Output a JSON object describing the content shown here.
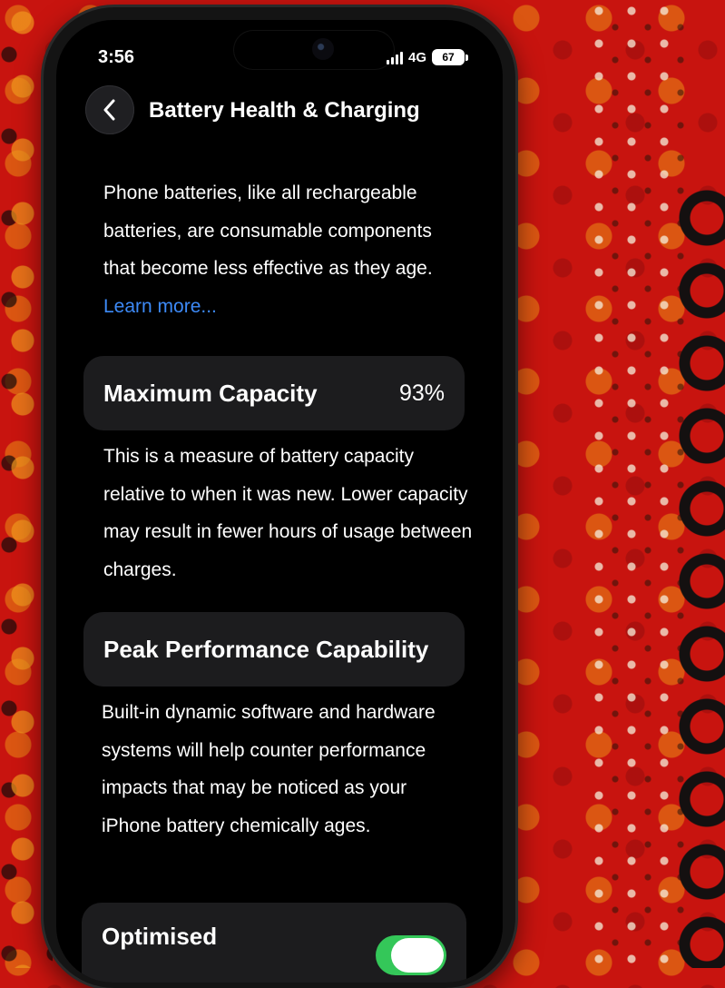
{
  "status_bar": {
    "time": "3:56",
    "network": "4G",
    "battery_level": "67",
    "signal_icon": "signal-bars-icon",
    "battery_icon": "battery-icon"
  },
  "nav": {
    "back_icon": "chevron-left-icon",
    "title": "Battery Health & Charging"
  },
  "intro": {
    "text": "Phone batteries, like all rechargeable batteries, are consumable components that become less effective as they age.",
    "link": "Learn more..."
  },
  "maximum_capacity": {
    "label": "Maximum Capacity",
    "value": "93%",
    "description": "This is a measure of battery capacity relative to when it was new. Lower capacity may result in fewer hours of usage between charges."
  },
  "peak_performance": {
    "label": "Peak Performance Capability",
    "description": "Built-in dynamic software and hardware systems will help counter performance impacts that may be noticed as your iPhone battery chemically ages."
  },
  "optimised": {
    "label": "Optimised",
    "toggle_on": true
  },
  "colors": {
    "accent_link": "#3d8af7",
    "toggle_on": "#34c759",
    "card_background": "#1c1c1e",
    "screen_background": "#000000"
  }
}
